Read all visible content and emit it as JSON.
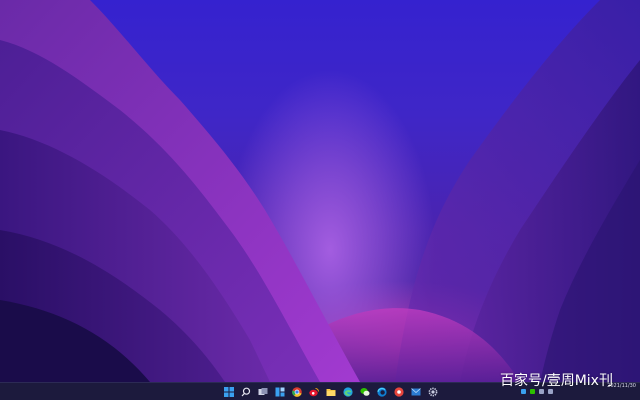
{
  "wallpaper": {
    "name": "purple-mountain-wallpaper",
    "colors": {
      "sky": "#3a23cc",
      "glow": "#a35de0",
      "magenta": "#d63cb2",
      "shadow": "#1a0c4a"
    }
  },
  "taskbar": {
    "background": "#1c1a3d",
    "icons": [
      {
        "name": "start-icon",
        "running": false
      },
      {
        "name": "search-icon",
        "running": false
      },
      {
        "name": "task-view-icon",
        "running": false
      },
      {
        "name": "widgets-icon",
        "running": false
      },
      {
        "name": "chrome-icon",
        "running": false
      },
      {
        "name": "weibo-icon",
        "running": false
      },
      {
        "name": "file-explorer-icon",
        "running": true
      },
      {
        "name": "edge-icon",
        "running": false
      },
      {
        "name": "wechat-icon",
        "running": true
      },
      {
        "name": "edge-browser-icon",
        "running": true
      },
      {
        "name": "red-app-icon",
        "running": true
      },
      {
        "name": "mail-icon",
        "running": true
      },
      {
        "name": "settings-icon",
        "running": true
      }
    ]
  },
  "tray": {
    "date": "2021/11/30"
  },
  "watermark": {
    "text": "百家号/壹周Mix刊"
  }
}
